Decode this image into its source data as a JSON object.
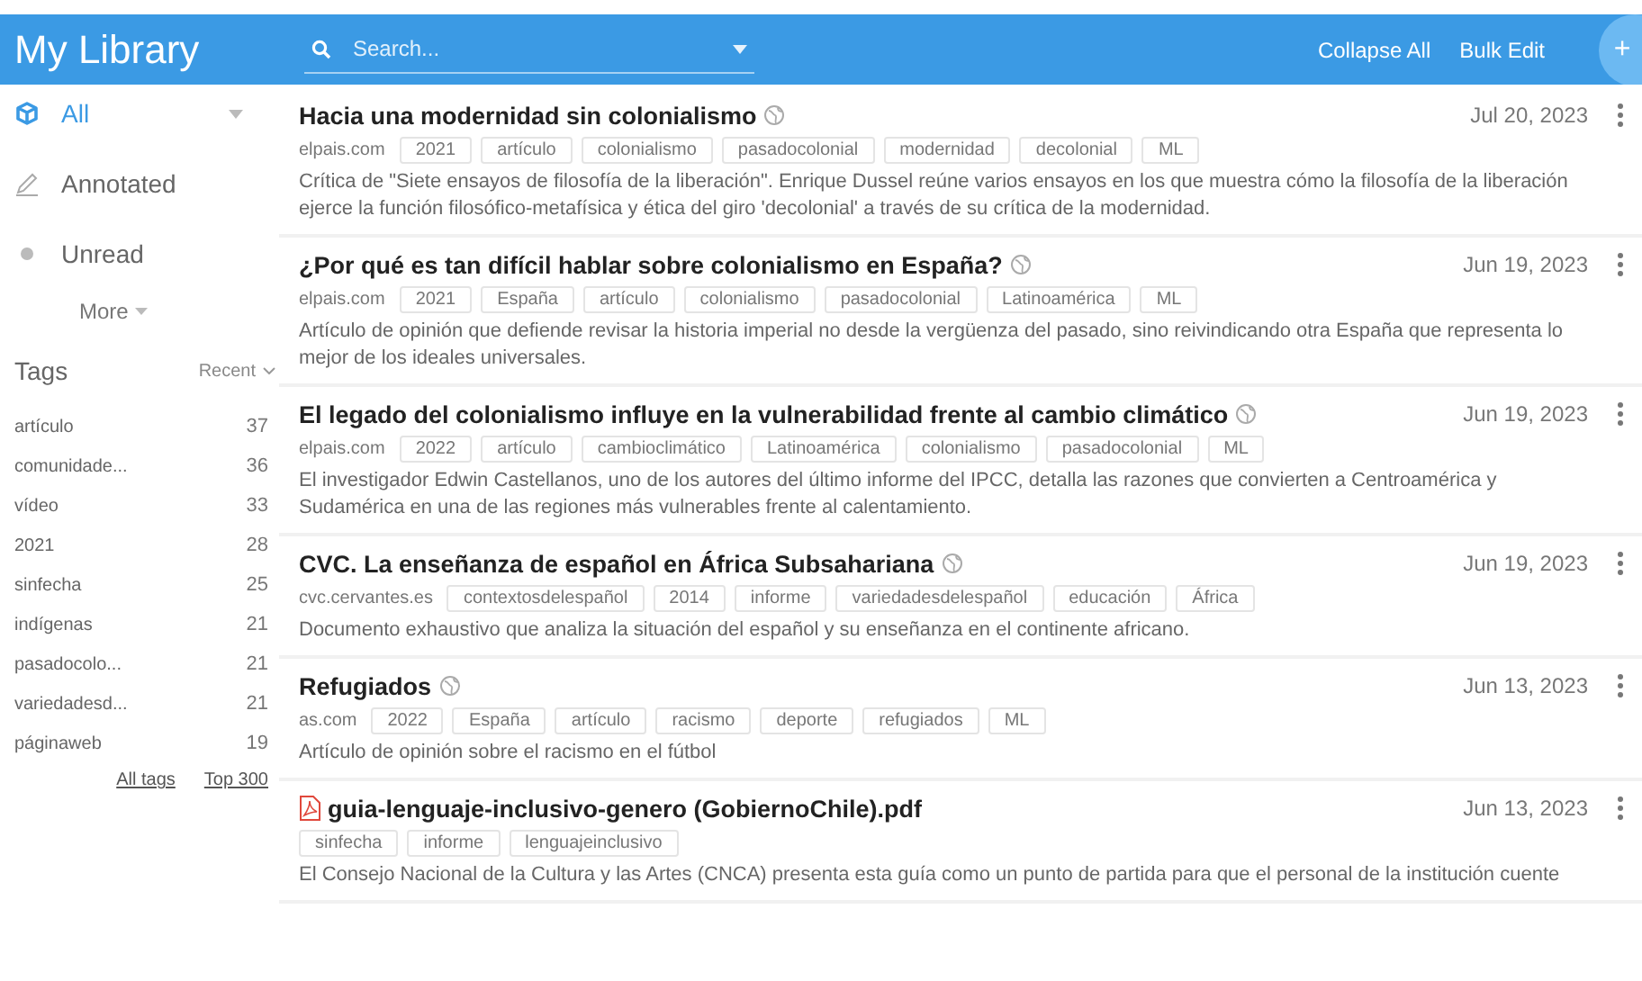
{
  "header": {
    "title": "My Library",
    "search": {
      "placeholder": "Search..."
    },
    "actions": [
      "Collapse All",
      "Bulk Edit"
    ],
    "add_button": "+"
  },
  "sidebar": {
    "nav": [
      {
        "kind": "all",
        "label": "All",
        "selected": true
      },
      {
        "kind": "annotated",
        "label": "Annotated",
        "selected": false
      },
      {
        "kind": "unread",
        "label": "Unread",
        "selected": false
      }
    ],
    "more": "More",
    "tags_heading": "Tags",
    "sort": "Recent",
    "tags": [
      {
        "name": "artículo",
        "count": "37"
      },
      {
        "name": "comunidade...",
        "count": "36"
      },
      {
        "name": "vídeo",
        "count": "33"
      },
      {
        "name": "2021",
        "count": "28"
      },
      {
        "name": "sinfecha",
        "count": "25"
      },
      {
        "name": "indígenas",
        "count": "21"
      },
      {
        "name": "pasadocolo...",
        "count": "21"
      },
      {
        "name": "variedadesd...",
        "count": "21"
      },
      {
        "name": "páginaweb",
        "count": "19"
      }
    ],
    "links": [
      "All tags",
      "Top 300"
    ]
  },
  "items": [
    {
      "kind": "web",
      "title": "Hacia una modernidad sin colonialismo",
      "date": "Jul 20, 2023",
      "source": "elpais.com",
      "tags": [
        "2021",
        "artículo",
        "colonialismo",
        "pasadocolonial",
        "modernidad",
        "decolonial",
        "ML"
      ],
      "description": "Crítica de \"Siete ensayos de filosofía de la liberación\". Enrique Dussel reúne varios ensayos en los que muestra cómo la filosofía de la liberación ejerce la función filosófico-metafísica y ética del giro 'decolonial' a través de su crítica de la modernidad."
    },
    {
      "kind": "web",
      "title": "¿Por qué es tan difícil hablar sobre colonialismo en España?",
      "date": "Jun 19, 2023",
      "source": "elpais.com",
      "tags": [
        "2021",
        "España",
        "artículo",
        "colonialismo",
        "pasadocolonial",
        "Latinoamérica",
        "ML"
      ],
      "description": "Artículo de opinión que defiende revisar la historia imperial no desde la vergüenza del pasado, sino reivindicando otra España que representa lo mejor de los ideales universales."
    },
    {
      "kind": "web",
      "title": "El legado del colonialismo influye en la vulnerabilidad frente al cambio climático",
      "date": "Jun 19, 2023",
      "source": "elpais.com",
      "tags": [
        "2022",
        "artículo",
        "cambioclimático",
        "Latinoamérica",
        "colonialismo",
        "pasadocolonial",
        "ML"
      ],
      "description": "El investigador Edwin Castellanos, uno de los autores del último informe del IPCC, detalla las razones que convierten a Centroamérica y Sudamérica en una de las regiones más vulnerables frente al calentamiento."
    },
    {
      "kind": "web",
      "title": "CVC. La enseñanza de español en África Subsahariana",
      "date": "Jun 19, 2023",
      "source": "cvc.cervantes.es",
      "tags": [
        "contextosdelespañol",
        "2014",
        "informe",
        "variedadesdelespañol",
        "educación",
        "África"
      ],
      "description": "Documento exhaustivo que analiza la situación del español y su enseñanza en el continente africano."
    },
    {
      "kind": "web",
      "title": "Refugiados",
      "date": "Jun 13, 2023",
      "source": "as.com",
      "tags": [
        "2022",
        "España",
        "artículo",
        "racismo",
        "deporte",
        "refugiados",
        "ML"
      ],
      "description": "Artículo de opinión sobre el racismo en el fútbol"
    },
    {
      "kind": "pdf",
      "title": "guia-lenguaje-inclusivo-genero (GobiernoChile).pdf",
      "date": "Jun 13, 2023",
      "tags": [
        "sinfecha",
        "informe",
        "lenguajeinclusivo"
      ],
      "description": "El Consejo Nacional de la Cultura y las Artes (CNCA) presenta esta guía como un punto de partida para que el personal de la institución cuente"
    }
  ]
}
